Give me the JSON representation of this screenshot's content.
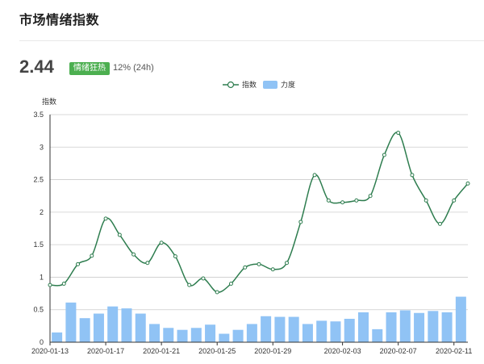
{
  "page": {
    "title": "市场情绪指数",
    "value": "2.44",
    "badge": "情绪狂热",
    "change": "12% (24h)"
  },
  "colors": {
    "line": "#2e7d4f",
    "bar": "#90c3f5",
    "badge": "#4caf50",
    "grid": "#cccccc"
  },
  "chart_data": {
    "type": "bar",
    "title": "",
    "legend": [
      "指数",
      "力度"
    ],
    "legend_placement": "top-center",
    "ylabel": "指数",
    "ylim": [
      0,
      3.5
    ],
    "yticks": [
      "0",
      "0.5",
      "1",
      "1.5",
      "2",
      "2.5",
      "3",
      "3.5"
    ],
    "grid": true,
    "x": [
      "2020-01-13",
      "2020-01-14",
      "2020-01-15",
      "2020-01-16",
      "2020-01-17",
      "2020-01-18",
      "2020-01-19",
      "2020-01-20",
      "2020-01-21",
      "2020-01-22",
      "2020-01-23",
      "2020-01-24",
      "2020-01-25",
      "2020-01-26",
      "2020-01-27",
      "2020-01-28",
      "2020-01-29",
      "2020-01-30",
      "2020-01-31",
      "2020-02-01",
      "2020-02-02",
      "2020-02-03",
      "2020-02-04",
      "2020-02-05",
      "2020-02-06",
      "2020-02-07",
      "2020-02-08",
      "2020-02-09",
      "2020-02-10",
      "2020-02-11",
      "2020-02-12"
    ],
    "x_tick_labels": [
      "2020-01-13",
      "2020-01-17",
      "2020-01-21",
      "2020-01-25",
      "2020-01-29",
      "2020-02-03",
      "2020-02-07",
      "2020-02-11"
    ],
    "series": [
      {
        "name": "指数",
        "type": "line",
        "values": [
          0.88,
          0.9,
          1.2,
          1.33,
          1.9,
          1.65,
          1.35,
          1.22,
          1.53,
          1.32,
          0.88,
          0.98,
          0.77,
          0.9,
          1.15,
          1.2,
          1.12,
          1.22,
          1.85,
          2.57,
          2.18,
          2.15,
          2.18,
          2.25,
          2.88,
          3.22,
          2.57,
          2.18,
          1.82,
          2.18,
          2.44
        ]
      },
      {
        "name": "力度",
        "type": "bar",
        "values": [
          0.15,
          0.61,
          0.37,
          0.44,
          0.55,
          0.52,
          0.44,
          0.28,
          0.22,
          0.19,
          0.22,
          0.27,
          0.13,
          0.19,
          0.28,
          0.4,
          0.39,
          0.39,
          0.28,
          0.33,
          0.32,
          0.36,
          0.46,
          0.2,
          0.46,
          0.49,
          0.45,
          0.48,
          0.46,
          0.7
        ]
      }
    ]
  }
}
